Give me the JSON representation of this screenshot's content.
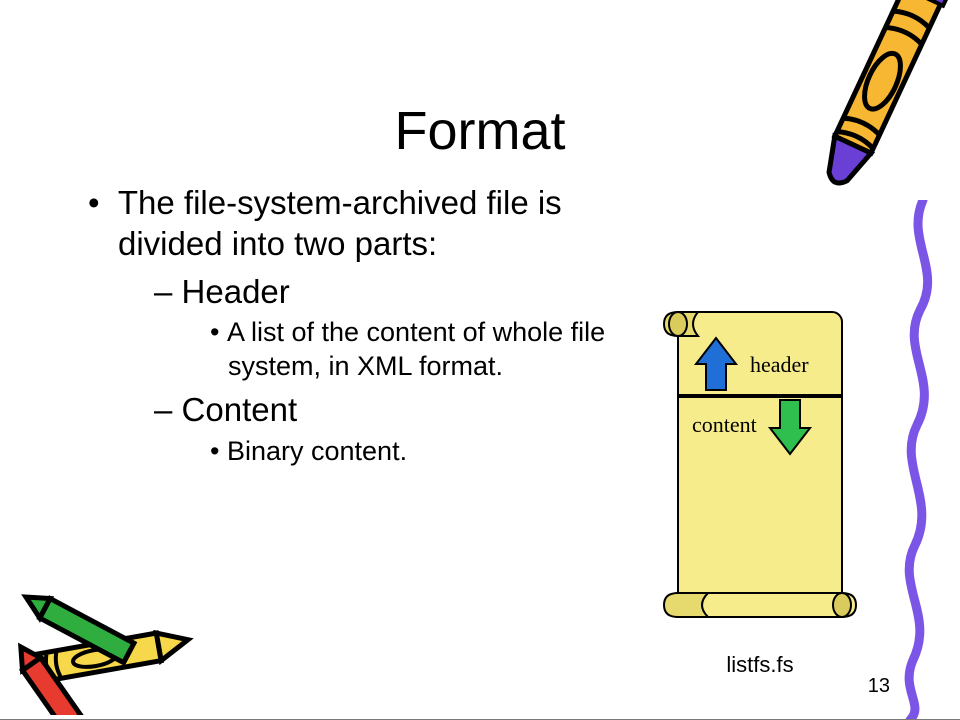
{
  "title": "Format",
  "bullets": {
    "main": "The file-system-archived file is divided into two parts:",
    "header_label": "Header",
    "header_detail": "A list of the content of whole file system, in XML format.",
    "content_label": "Content",
    "content_detail": "Binary content."
  },
  "diagram": {
    "header": "header",
    "content": "content",
    "caption": "listfs.fs"
  },
  "page_number": "13"
}
